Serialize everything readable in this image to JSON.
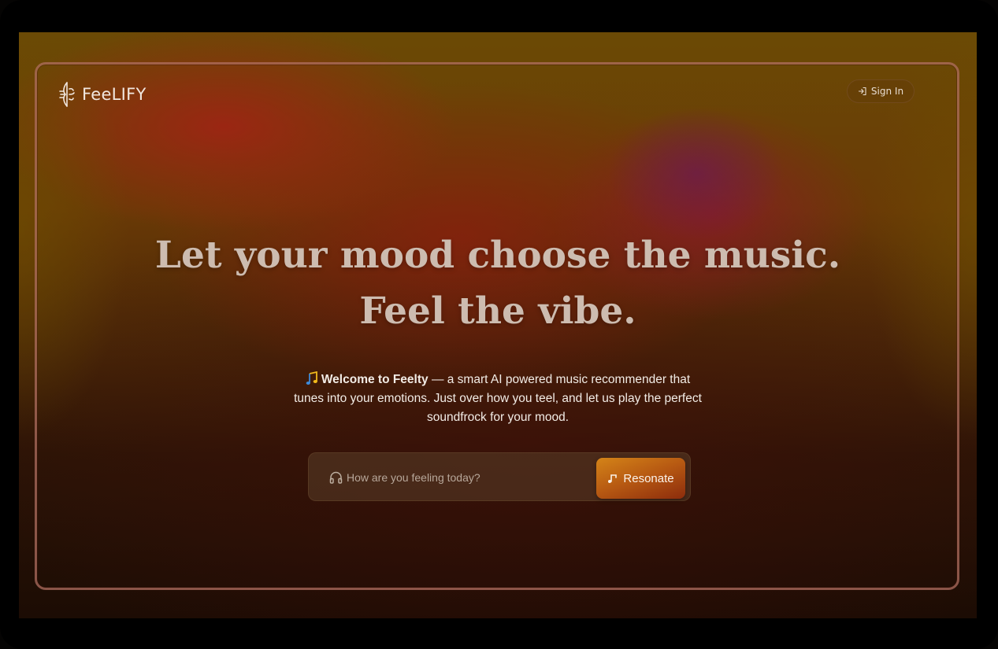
{
  "app": {
    "brand": "FeeLIFY",
    "logo_icon": "tuning-fork-wave-icon"
  },
  "header": {
    "signin_label": "Sign In",
    "signin_icon": "sign-in-icon"
  },
  "hero": {
    "headline_line1": "Let your mood choose the music.",
    "headline_line2": "Feel the vibe.",
    "intro_icon": "music-note-icon",
    "intro_bold": "Welcome to Feelty",
    "intro_line1_rest": " — a smart  AI  powered music recommender that",
    "intro_line2": "tunes into your emotions.  Just over how you teel, and let us play the perfect",
    "intro_line3": "soundfrock for your mood."
  },
  "search": {
    "icon": "headphones-icon",
    "placeholder": "How are you feeling today?",
    "value": "",
    "button_label": "Resonate",
    "button_icon": "music-note-icon"
  },
  "colors": {
    "accent_start": "#d48418",
    "accent_end": "#8c2c0c",
    "headline": "#cdbcb0",
    "frame_border": "#af6e5f"
  }
}
